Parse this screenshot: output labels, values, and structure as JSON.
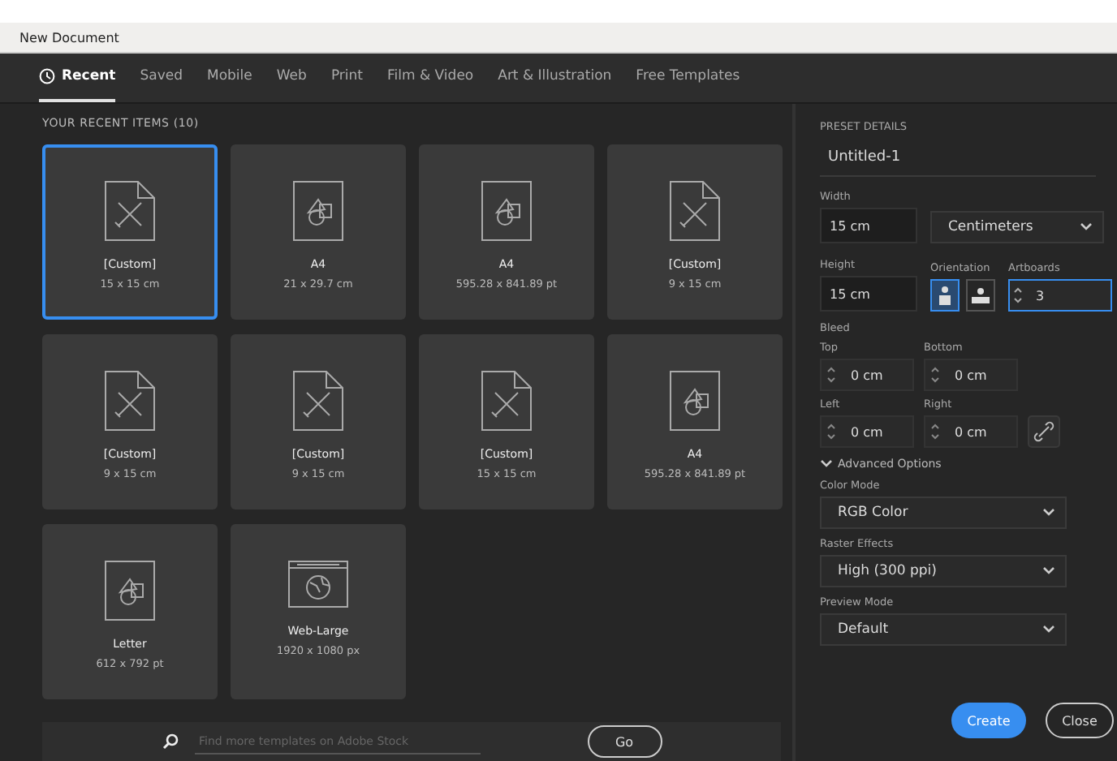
{
  "window": {
    "title": "New Document"
  },
  "tabs": [
    {
      "label": "Recent",
      "selected": true
    },
    {
      "label": "Saved",
      "selected": false
    },
    {
      "label": "Mobile",
      "selected": false
    },
    {
      "label": "Web",
      "selected": false
    },
    {
      "label": "Print",
      "selected": false
    },
    {
      "label": "Film & Video",
      "selected": false
    },
    {
      "label": "Art & Illustration",
      "selected": false
    },
    {
      "label": "Free Templates",
      "selected": false
    }
  ],
  "recent": {
    "heading": "YOUR RECENT ITEMS",
    "count": "(10)",
    "items": [
      {
        "kind": "pencil",
        "name": "[Custom]",
        "size": "15 x 15 cm",
        "selected": true
      },
      {
        "kind": "shapes",
        "name": "A4",
        "size": "21 x 29.7 cm",
        "selected": false
      },
      {
        "kind": "shapes",
        "name": "A4",
        "size": "595.28 x 841.89 pt",
        "selected": false
      },
      {
        "kind": "pencil",
        "name": "[Custom]",
        "size": "9 x 15 cm",
        "selected": false
      },
      {
        "kind": "pencil",
        "name": "[Custom]",
        "size": "9 x 15 cm",
        "selected": false
      },
      {
        "kind": "pencil",
        "name": "[Custom]",
        "size": "9 x 15 cm",
        "selected": false
      },
      {
        "kind": "pencil",
        "name": "[Custom]",
        "size": "15 x 15 cm",
        "selected": false
      },
      {
        "kind": "shapes",
        "name": "A4",
        "size": "595.28 x 841.89 pt",
        "selected": false
      },
      {
        "kind": "shapes",
        "name": "Letter",
        "size": "612 x 792 pt",
        "selected": false
      },
      {
        "kind": "web",
        "name": "Web-Large",
        "size": "1920 x 1080 px",
        "selected": false
      }
    ]
  },
  "search": {
    "placeholder": "Find more templates on Adobe Stock",
    "button": "Go"
  },
  "preset": {
    "heading": "PRESET DETAILS",
    "name": "Untitled-1",
    "width_label": "Width",
    "width": "15 cm",
    "units": "Centimeters",
    "height_label": "Height",
    "height": "15 cm",
    "orientation_label": "Orientation",
    "orientations": [
      {
        "kind": "portrait",
        "selected": true
      },
      {
        "kind": "landscape",
        "selected": false
      }
    ],
    "artboards_label": "Artboards",
    "artboards": "3",
    "bleed_label": "Bleed",
    "bleed": [
      {
        "label": "Top",
        "value": "0 cm"
      },
      {
        "label": "Bottom",
        "value": "0 cm"
      },
      {
        "label": "Left",
        "value": "0 cm"
      },
      {
        "label": "Right",
        "value": "0 cm"
      }
    ],
    "advanced": {
      "label": "Advanced Options",
      "expanded": true
    },
    "selects": [
      {
        "label": "Color Mode",
        "value": "RGB Color"
      },
      {
        "label": "Raster Effects",
        "value": "High (300 ppi)"
      },
      {
        "label": "Preview Mode",
        "value": "Default"
      }
    ]
  },
  "buttons": {
    "create": "Create",
    "close": "Close"
  }
}
